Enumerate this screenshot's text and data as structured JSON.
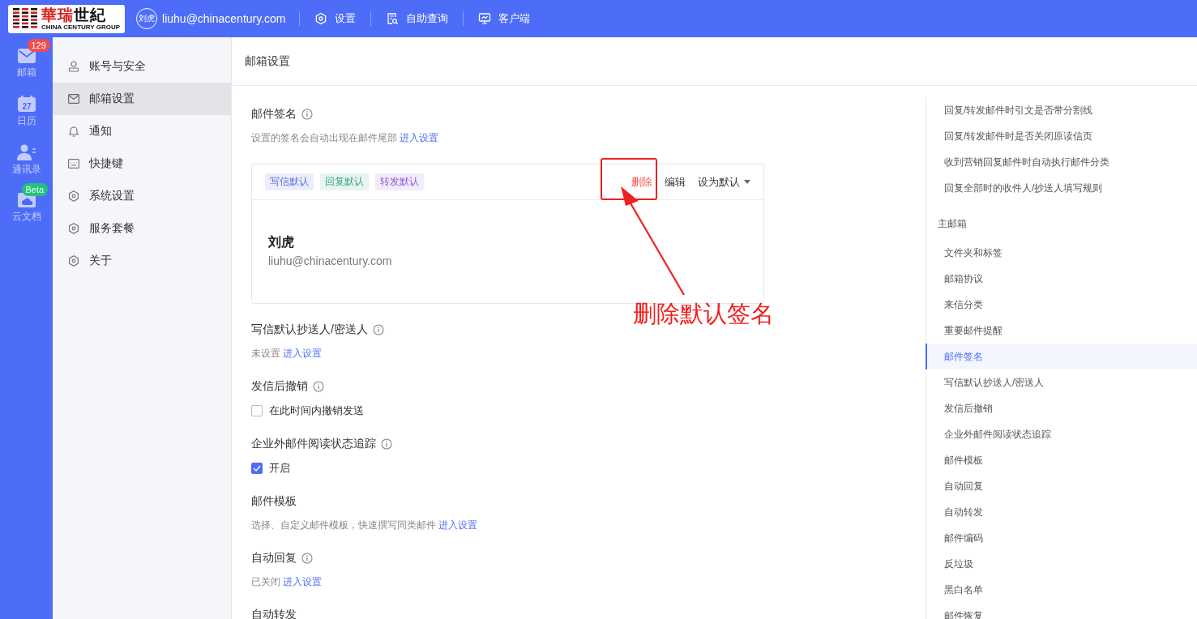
{
  "header": {
    "logo": {
      "name_red": "華瑞",
      "name_dark": "世紀",
      "subtitle": "CHINA CENTURY GROUP"
    },
    "avatar_text": "刘虎",
    "email": "liuhu@chinacentury.com",
    "nav": [
      {
        "label": "设置"
      },
      {
        "label": "自助查询"
      },
      {
        "label": "客户端"
      }
    ]
  },
  "rail": [
    {
      "label": "邮箱",
      "badge": {
        "text": "129",
        "color": "#f24c4c"
      }
    },
    {
      "label": "日历",
      "day": "27"
    },
    {
      "label": "通讯录"
    },
    {
      "label": "云文档",
      "badge": {
        "text": "Beta",
        "color": "#1fc37b"
      }
    }
  ],
  "sidebar": {
    "items": [
      {
        "label": "账号与安全",
        "selected": false
      },
      {
        "label": "邮箱设置",
        "selected": true
      },
      {
        "label": "通知",
        "selected": false
      },
      {
        "label": "快捷键",
        "selected": false
      },
      {
        "label": "系统设置",
        "selected": false
      },
      {
        "label": "服务套餐",
        "selected": false
      },
      {
        "label": "关于",
        "selected": false
      }
    ]
  },
  "page_title": "邮箱设置",
  "sections": [
    {
      "title": "邮件签名",
      "info": true,
      "kind": "signature",
      "desc": "设置的签名会自动出现在邮件尾部",
      "link": "进入设置",
      "signature": {
        "tags": [
          {
            "label": "写信默认",
            "color": "#5b6ee1"
          },
          {
            "label": "回复默认",
            "color": "#3aa87a"
          },
          {
            "label": "转发默认",
            "color": "#8a5ad8"
          }
        ],
        "actions": [
          {
            "label": "删除",
            "kind": "danger"
          },
          {
            "label": "编辑",
            "kind": "plain"
          },
          {
            "label": "设为默认",
            "kind": "dropdown"
          }
        ],
        "name": "刘虎",
        "email": "liuhu@chinacentury.com"
      }
    },
    {
      "title": "写信默认抄送人/密送人",
      "info": true,
      "kind": "desc",
      "desc": "未设置",
      "link": "进入设置"
    },
    {
      "title": "发信后撤销",
      "info": true,
      "kind": "checkbox",
      "checkbox": {
        "label": "在此时间内撤销发送",
        "checked": false
      }
    },
    {
      "title": "企业外邮件阅读状态追踪",
      "info": true,
      "kind": "checkbox",
      "checkbox": {
        "label": "开启",
        "checked": true
      }
    },
    {
      "title": "邮件模板",
      "info": false,
      "kind": "desc",
      "desc": "选择、自定义邮件模板，快速撰写同类邮件",
      "link": "进入设置"
    },
    {
      "title": "自动回复",
      "info": true,
      "kind": "desc",
      "desc": "已关闭",
      "link": "进入设置"
    },
    {
      "title": "自动转发",
      "info": false,
      "kind": "title"
    }
  ],
  "anchors": [
    {
      "label": "回复/转发邮件时引文是否带分割线",
      "kind": "item",
      "selected": false
    },
    {
      "label": "回复/转发邮件时是否关闭原读信页",
      "kind": "item",
      "selected": false
    },
    {
      "label": "收到营销回复邮件时自动执行邮件分类",
      "kind": "item",
      "selected": false
    },
    {
      "label": "回复全部时的收件人/抄送人填写规则",
      "kind": "item",
      "selected": false
    },
    {
      "label": "主邮箱",
      "kind": "heading"
    },
    {
      "label": "文件夹和标签",
      "kind": "item",
      "selected": false
    },
    {
      "label": "邮箱协议",
      "kind": "item",
      "selected": false
    },
    {
      "label": "来信分类",
      "kind": "item",
      "selected": false
    },
    {
      "label": "重要邮件提醒",
      "kind": "item",
      "selected": false
    },
    {
      "label": "邮件签名",
      "kind": "item",
      "selected": true
    },
    {
      "label": "写信默认抄送人/密送人",
      "kind": "item",
      "selected": false
    },
    {
      "label": "发信后撤销",
      "kind": "item",
      "selected": false
    },
    {
      "label": "企业外邮件阅读状态追踪",
      "kind": "item",
      "selected": false
    },
    {
      "label": "邮件模板",
      "kind": "item",
      "selected": false
    },
    {
      "label": "自动回复",
      "kind": "item",
      "selected": false
    },
    {
      "label": "自动转发",
      "kind": "item",
      "selected": false
    },
    {
      "label": "邮件编码",
      "kind": "item",
      "selected": false
    },
    {
      "label": "反垃圾",
      "kind": "item",
      "selected": false
    },
    {
      "label": "黑白名单",
      "kind": "item",
      "selected": false
    },
    {
      "label": "邮件恢复",
      "kind": "item",
      "selected": false
    }
  ],
  "annotation": {
    "label": "删除默认签名"
  }
}
